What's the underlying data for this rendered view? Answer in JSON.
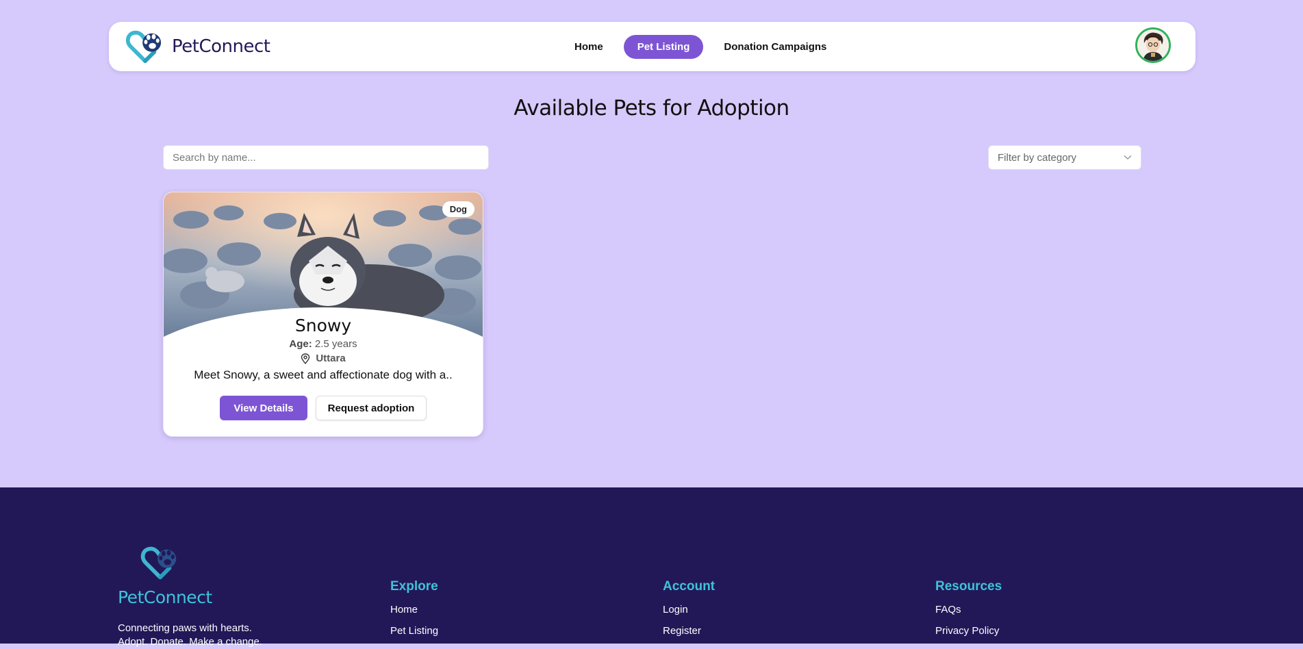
{
  "header": {
    "brand": "PetConnect",
    "nav": [
      {
        "label": "Home",
        "active": false
      },
      {
        "label": "Pet Listing",
        "active": true
      },
      {
        "label": "Donation Campaigns",
        "active": false
      }
    ]
  },
  "main": {
    "title": "Available Pets for Adoption",
    "search_placeholder": "Search by name...",
    "filter_label": "Filter by category"
  },
  "pet": {
    "category": "Dog",
    "name": "Snowy",
    "age_label": "Age:",
    "age": "2.5 years",
    "location": "Uttara",
    "description": "Meet Snowy, a sweet and affectionate dog with a..",
    "details_label": "View Details",
    "adopt_label": "Request adoption"
  },
  "footer": {
    "brand": "PetConnect",
    "tagline": "Connecting paws with hearts. Adopt. Donate. Make a change.",
    "explore": {
      "title": "Explore",
      "links": [
        "Home",
        "Pet Listing"
      ]
    },
    "account": {
      "title": "Account",
      "links": [
        "Login",
        "Register"
      ]
    },
    "resources": {
      "title": "Resources",
      "links": [
        "FAQs",
        "Privacy Policy"
      ]
    }
  },
  "colors": {
    "accent": "#7d55d4",
    "background": "#d6c9fb",
    "footer_bg": "#221858",
    "footer_heading": "#3fc3d8"
  }
}
